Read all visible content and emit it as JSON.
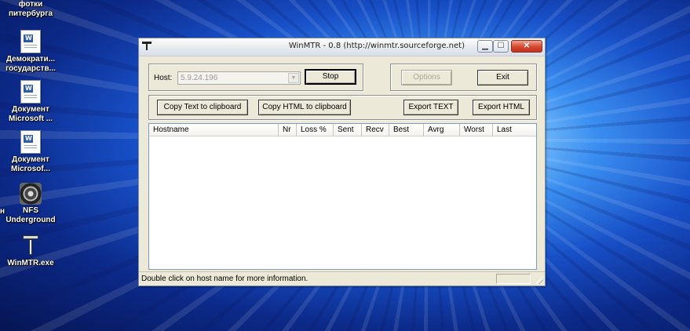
{
  "desktop": {
    "icons": [
      {
        "label_lines": [
          "фотки",
          "питербурга"
        ],
        "icon": "folder-icon"
      },
      {
        "label_lines": [
          "Демократи...",
          "государств..."
        ],
        "icon": "word-document-icon"
      },
      {
        "label_lines": [
          "Документ",
          "Microsoft ..."
        ],
        "icon": "word-document-icon"
      },
      {
        "label_lines": [
          "Документ",
          "Microsof..."
        ],
        "icon": "word-document-icon"
      },
      {
        "label_lines": [
          "NFS",
          "Underground"
        ],
        "icon": "nfs-game-icon"
      },
      {
        "label_lines": [
          "WinMTR.exe"
        ],
        "icon": "winmtr-icon"
      }
    ],
    "edge_fragment": "н"
  },
  "window": {
    "title": "WinMTR - 0.8 (http://winmtr.sourceforge.net)",
    "controls": {
      "minimize": "▁",
      "maximize": "☐",
      "close": "✕"
    },
    "host": {
      "label": "Host:",
      "value": "5.9.24.196"
    },
    "buttons": {
      "stop": "Stop",
      "options": "Options",
      "exit": "Exit",
      "copy_text": "Copy Text to clipboard",
      "copy_html": "Copy HTML to clipboard",
      "export_text": "Export TEXT",
      "export_html": "Export HTML"
    },
    "columns": [
      "Hostname",
      "Nr",
      "Loss %",
      "Sent",
      "Recv",
      "Best",
      "Avrg",
      "Worst",
      "Last"
    ],
    "rows": [],
    "status": "Double click on host name for more information."
  }
}
